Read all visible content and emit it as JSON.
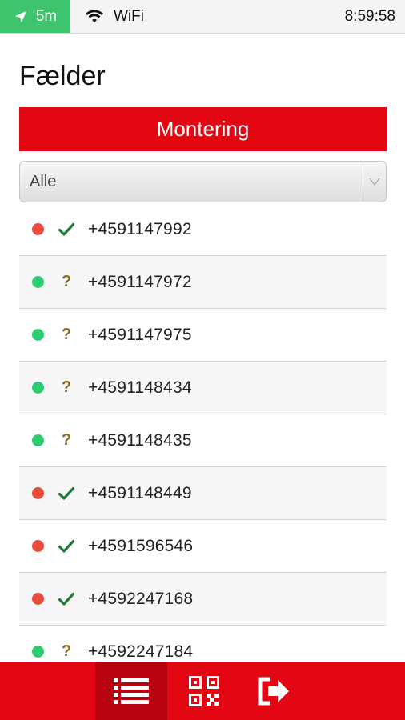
{
  "statusbar": {
    "location_label": "5m",
    "network": "WiFi",
    "time": "8:59:58"
  },
  "page": {
    "title": "Fælder"
  },
  "montering_button": {
    "label": "Montering"
  },
  "filter": {
    "selected": "Alle"
  },
  "colors": {
    "red": "#e30613",
    "green_dot": "#2ecc71",
    "red_dot": "#e74c3c",
    "check": "#1e7b34",
    "question": "#8a6d1d"
  },
  "traps": [
    {
      "number": "+4591147992",
      "dot": "red",
      "mark": "check"
    },
    {
      "number": "+4591147972",
      "dot": "green",
      "mark": "question"
    },
    {
      "number": "+4591147975",
      "dot": "green",
      "mark": "question"
    },
    {
      "number": "+4591148434",
      "dot": "green",
      "mark": "question"
    },
    {
      "number": "+4591148435",
      "dot": "green",
      "mark": "question"
    },
    {
      "number": "+4591148449",
      "dot": "red",
      "mark": "check"
    },
    {
      "number": "+4591596546",
      "dot": "red",
      "mark": "check"
    },
    {
      "number": "+4592247168",
      "dot": "red",
      "mark": "check"
    },
    {
      "number": "+4592247184",
      "dot": "green",
      "mark": "question"
    }
  ],
  "tabs": [
    {
      "name": "list",
      "icon": "list-icon",
      "active": true
    },
    {
      "name": "qr",
      "icon": "qr-code-icon",
      "active": false
    },
    {
      "name": "logout",
      "icon": "logout-icon",
      "active": false
    }
  ]
}
